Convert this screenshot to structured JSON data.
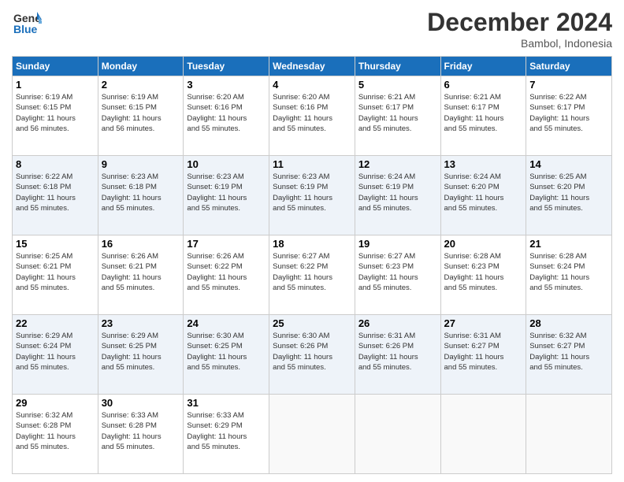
{
  "header": {
    "logo_line1": "General",
    "logo_line2": "Blue",
    "month": "December 2024",
    "location": "Bambol, Indonesia"
  },
  "days_of_week": [
    "Sunday",
    "Monday",
    "Tuesday",
    "Wednesday",
    "Thursday",
    "Friday",
    "Saturday"
  ],
  "weeks": [
    [
      {
        "day": "1",
        "info": "Sunrise: 6:19 AM\nSunset: 6:15 PM\nDaylight: 11 hours\nand 56 minutes."
      },
      {
        "day": "2",
        "info": "Sunrise: 6:19 AM\nSunset: 6:15 PM\nDaylight: 11 hours\nand 56 minutes."
      },
      {
        "day": "3",
        "info": "Sunrise: 6:20 AM\nSunset: 6:16 PM\nDaylight: 11 hours\nand 55 minutes."
      },
      {
        "day": "4",
        "info": "Sunrise: 6:20 AM\nSunset: 6:16 PM\nDaylight: 11 hours\nand 55 minutes."
      },
      {
        "day": "5",
        "info": "Sunrise: 6:21 AM\nSunset: 6:17 PM\nDaylight: 11 hours\nand 55 minutes."
      },
      {
        "day": "6",
        "info": "Sunrise: 6:21 AM\nSunset: 6:17 PM\nDaylight: 11 hours\nand 55 minutes."
      },
      {
        "day": "7",
        "info": "Sunrise: 6:22 AM\nSunset: 6:17 PM\nDaylight: 11 hours\nand 55 minutes."
      }
    ],
    [
      {
        "day": "8",
        "info": "Sunrise: 6:22 AM\nSunset: 6:18 PM\nDaylight: 11 hours\nand 55 minutes."
      },
      {
        "day": "9",
        "info": "Sunrise: 6:23 AM\nSunset: 6:18 PM\nDaylight: 11 hours\nand 55 minutes."
      },
      {
        "day": "10",
        "info": "Sunrise: 6:23 AM\nSunset: 6:19 PM\nDaylight: 11 hours\nand 55 minutes."
      },
      {
        "day": "11",
        "info": "Sunrise: 6:23 AM\nSunset: 6:19 PM\nDaylight: 11 hours\nand 55 minutes."
      },
      {
        "day": "12",
        "info": "Sunrise: 6:24 AM\nSunset: 6:19 PM\nDaylight: 11 hours\nand 55 minutes."
      },
      {
        "day": "13",
        "info": "Sunrise: 6:24 AM\nSunset: 6:20 PM\nDaylight: 11 hours\nand 55 minutes."
      },
      {
        "day": "14",
        "info": "Sunrise: 6:25 AM\nSunset: 6:20 PM\nDaylight: 11 hours\nand 55 minutes."
      }
    ],
    [
      {
        "day": "15",
        "info": "Sunrise: 6:25 AM\nSunset: 6:21 PM\nDaylight: 11 hours\nand 55 minutes."
      },
      {
        "day": "16",
        "info": "Sunrise: 6:26 AM\nSunset: 6:21 PM\nDaylight: 11 hours\nand 55 minutes."
      },
      {
        "day": "17",
        "info": "Sunrise: 6:26 AM\nSunset: 6:22 PM\nDaylight: 11 hours\nand 55 minutes."
      },
      {
        "day": "18",
        "info": "Sunrise: 6:27 AM\nSunset: 6:22 PM\nDaylight: 11 hours\nand 55 minutes."
      },
      {
        "day": "19",
        "info": "Sunrise: 6:27 AM\nSunset: 6:23 PM\nDaylight: 11 hours\nand 55 minutes."
      },
      {
        "day": "20",
        "info": "Sunrise: 6:28 AM\nSunset: 6:23 PM\nDaylight: 11 hours\nand 55 minutes."
      },
      {
        "day": "21",
        "info": "Sunrise: 6:28 AM\nSunset: 6:24 PM\nDaylight: 11 hours\nand 55 minutes."
      }
    ],
    [
      {
        "day": "22",
        "info": "Sunrise: 6:29 AM\nSunset: 6:24 PM\nDaylight: 11 hours\nand 55 minutes."
      },
      {
        "day": "23",
        "info": "Sunrise: 6:29 AM\nSunset: 6:25 PM\nDaylight: 11 hours\nand 55 minutes."
      },
      {
        "day": "24",
        "info": "Sunrise: 6:30 AM\nSunset: 6:25 PM\nDaylight: 11 hours\nand 55 minutes."
      },
      {
        "day": "25",
        "info": "Sunrise: 6:30 AM\nSunset: 6:26 PM\nDaylight: 11 hours\nand 55 minutes."
      },
      {
        "day": "26",
        "info": "Sunrise: 6:31 AM\nSunset: 6:26 PM\nDaylight: 11 hours\nand 55 minutes."
      },
      {
        "day": "27",
        "info": "Sunrise: 6:31 AM\nSunset: 6:27 PM\nDaylight: 11 hours\nand 55 minutes."
      },
      {
        "day": "28",
        "info": "Sunrise: 6:32 AM\nSunset: 6:27 PM\nDaylight: 11 hours\nand 55 minutes."
      }
    ],
    [
      {
        "day": "29",
        "info": "Sunrise: 6:32 AM\nSunset: 6:28 PM\nDaylight: 11 hours\nand 55 minutes."
      },
      {
        "day": "30",
        "info": "Sunrise: 6:33 AM\nSunset: 6:28 PM\nDaylight: 11 hours\nand 55 minutes."
      },
      {
        "day": "31",
        "info": "Sunrise: 6:33 AM\nSunset: 6:29 PM\nDaylight: 11 hours\nand 55 minutes."
      },
      null,
      null,
      null,
      null
    ]
  ]
}
